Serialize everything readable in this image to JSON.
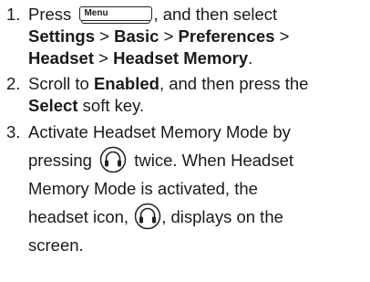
{
  "steps": [
    {
      "number": "1.",
      "press": "Press",
      "menu_key": "Menu",
      "then_select": ", and then select",
      "path": [
        "Settings",
        "Basic",
        "Preferences",
        "Headset",
        "Headset Memory"
      ],
      "sep": ">",
      "end": "."
    },
    {
      "number": "2.",
      "scroll_to": "Scroll to",
      "enabled": "Enabled",
      "then_press": ", and then press the",
      "select": "Select",
      "soft_key": "soft key."
    },
    {
      "number": "3.",
      "activate": "Activate Headset Memory Mode by",
      "pressing": "pressing",
      "twice": "twice. When Headset",
      "line3": "Memory Mode is activated, the",
      "headset_icon_text": "headset icon,",
      "displays": ", displays on the",
      "screen": "screen."
    }
  ],
  "icons": {
    "headset_key": "headset-icon",
    "menu_key": "menu-key-icon"
  }
}
